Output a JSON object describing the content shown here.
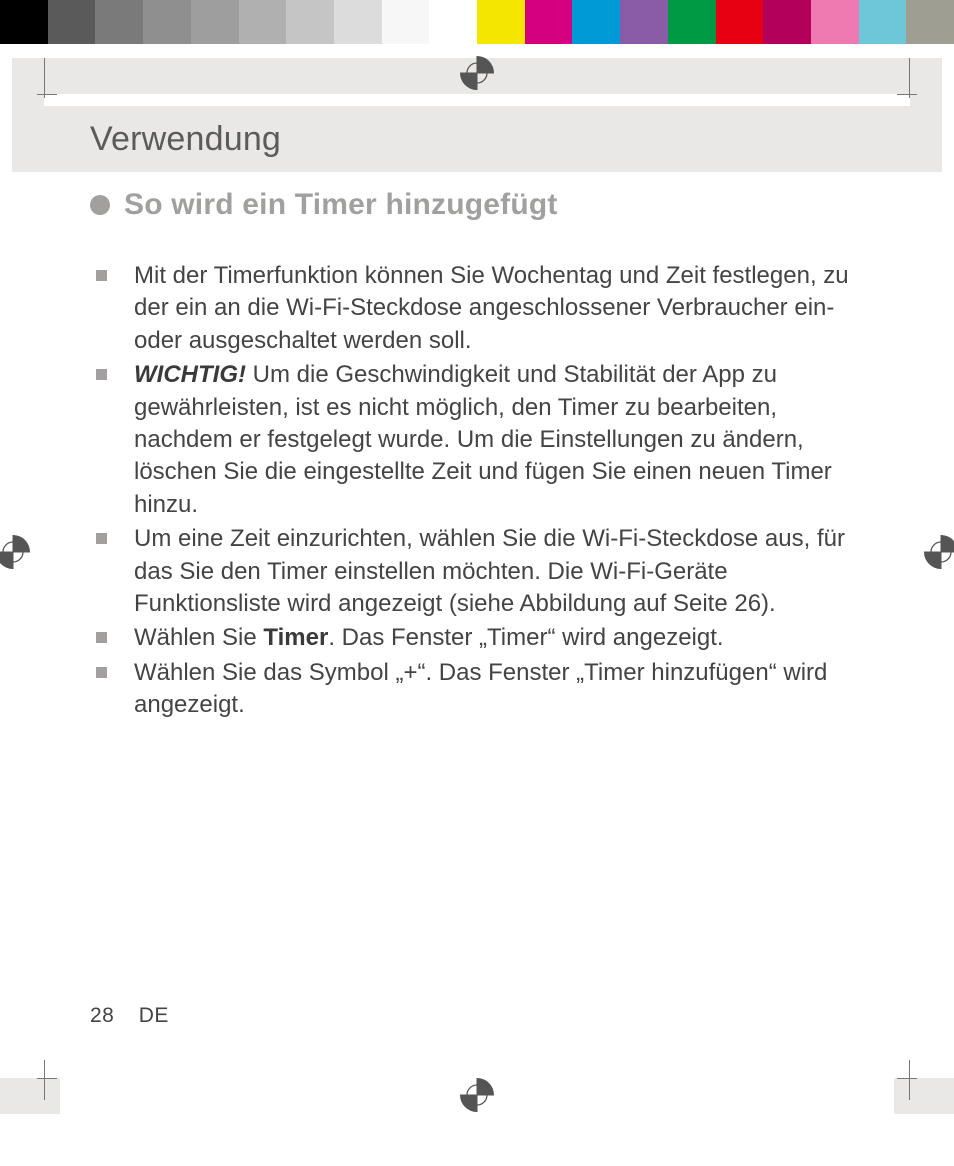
{
  "header": {
    "title": "Verwendung"
  },
  "subheading": "So wird ein Timer hinzugefügt",
  "bullets": [
    {
      "type": "plain",
      "text": "Mit der Timerfunktion können Sie Wochentag und Zeit festlegen, zu der ein an die Wi-Fi-Steckdose angeschlossener Verbraucher ein- oder ausgeschaltet werden soll."
    },
    {
      "type": "important",
      "lead": "WICHTIG!",
      "text": " Um die Geschwindigkeit und Stabilität der App zu gewährleisten, ist es nicht möglich, den Timer zu bearbeiten, nachdem er festgelegt wurde. Um die Einstellungen zu ändern, löschen Sie die eingestellte Zeit und fügen Sie einen neuen Timer hinzu."
    },
    {
      "type": "plain",
      "text": "Um eine Zeit einzurichten, wählen Sie die Wi-Fi-Steckdose aus, für das Sie den Timer einstellen möchten. Die Wi-Fi-Geräte Funktionsliste wird angezeigt (siehe Abbildung auf Seite 26)."
    },
    {
      "type": "bold-inline",
      "pre": "Wählen Sie ",
      "bold": "Timer",
      "post": ". Das Fenster „Timer“ wird angezeigt."
    },
    {
      "type": "plain",
      "text": "Wählen Sie das Symbol „+“. Das Fenster „Timer hinzufügen“ wird angezeigt."
    }
  ],
  "footer": {
    "page": "28",
    "lang": "DE"
  },
  "calibration_colors_left": [
    "#000000",
    "#5a5a5a",
    "#7a7a7a",
    "#8f8f8f",
    "#9e9e9e",
    "#b0b0b0",
    "#c5c5c5",
    "#dcdcdc",
    "#f7f7f7"
  ],
  "calibration_colors_right": [
    "#f5e600",
    "#d4007f",
    "#009ad6",
    "#8a5ca8",
    "#009944",
    "#e60012",
    "#b3005b",
    "#ef7ab1",
    "#6ec6d9",
    "#9e9e92"
  ]
}
